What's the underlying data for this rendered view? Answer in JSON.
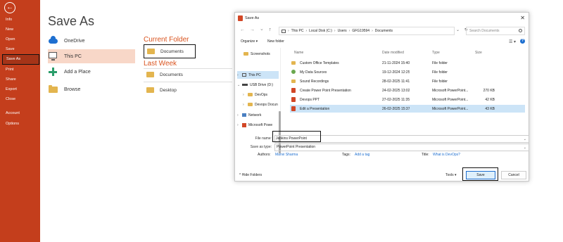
{
  "backstage": {
    "nav": [
      "Info",
      "New",
      "Open",
      "Save",
      "Save As",
      "Print",
      "Share",
      "Export",
      "Close",
      "Account",
      "Options"
    ],
    "active": "Save As"
  },
  "save_as": {
    "title": "Save As",
    "locations": [
      "OneDrive",
      "This PC",
      "Add a Place",
      "Browse"
    ],
    "current_folder_title": "Current Folder",
    "current_folder": "Documents",
    "last_week_title": "Last Week",
    "last_week": [
      "Documents",
      "Desktop"
    ]
  },
  "dialog": {
    "title": "Save As",
    "close_glyph": "✕",
    "nav_glyphs": [
      "←",
      "→",
      "⌄",
      "↑"
    ],
    "breadcrumb": [
      "This PC",
      "Local Disk (C:)",
      "Users",
      "GFG19594",
      "Documents"
    ],
    "breadcrumb_sep": "›",
    "dropdown_glyph": "⌄",
    "refresh_glyph": "↻",
    "search_placeholder": "Search Documents",
    "organize": "Organize ▾",
    "new_folder": "New folder",
    "view_glyph": "☰ ▾",
    "help_glyph": "?",
    "tree": [
      {
        "label": "Screenshots",
        "arrow": ""
      },
      {
        "label": "This PC",
        "arrow": "›"
      },
      {
        "label": "USB Drive (D:)",
        "arrow": "⌄"
      },
      {
        "label": "DevOps",
        "arrow": "›"
      },
      {
        "label": "Devops Docun",
        "arrow": "›"
      },
      {
        "label": "Network",
        "arrow": "›"
      },
      {
        "label": "Microsoft Powe",
        "arrow": "›"
      }
    ],
    "columns": [
      "Name",
      "Date modified",
      "Type",
      "Size"
    ],
    "files": [
      {
        "name": "Custom Office Templates",
        "date": "21-11-2024 15:40",
        "type": "File folder",
        "size": "",
        "icon": "folder"
      },
      {
        "name": "My Data Sources",
        "date": "19-12-2024 12:25",
        "type": "File folder",
        "size": "",
        "icon": "gear"
      },
      {
        "name": "Sound Recordings",
        "date": "28-02-2025 11:41",
        "type": "File folder",
        "size": "",
        "icon": "folder"
      },
      {
        "name": "Create Power Point Presentation",
        "date": "24-02-2025 13:02",
        "type": "Microsoft PowerPoint...",
        "size": "270 KB",
        "icon": "ppt"
      },
      {
        "name": "Devops PPT",
        "date": "27-02-2025 11:35",
        "type": "Microsoft PowerPoint...",
        "size": "42 KB",
        "icon": "ppt"
      },
      {
        "name": "Edit a Presentation",
        "date": "26-02-2025 15:37",
        "type": "Microsoft PowerPoint...",
        "size": "43 KB",
        "icon": "ppt"
      }
    ],
    "file_name_label": "File name:",
    "file_name": "Jenkins PowerPoint",
    "save_type_label": "Save as type:",
    "save_type": "PowerPoint Presentation",
    "authors_label": "Authors:",
    "authors": "Manvi Sharma",
    "tags_label": "Tags:",
    "tags": "Add a tag",
    "title_label": "Title:",
    "title_value": "What is DevOps?",
    "hide_folders": "^ Hide Folders",
    "tools": "Tools ▾",
    "save": "Save",
    "cancel": "Cancel"
  }
}
